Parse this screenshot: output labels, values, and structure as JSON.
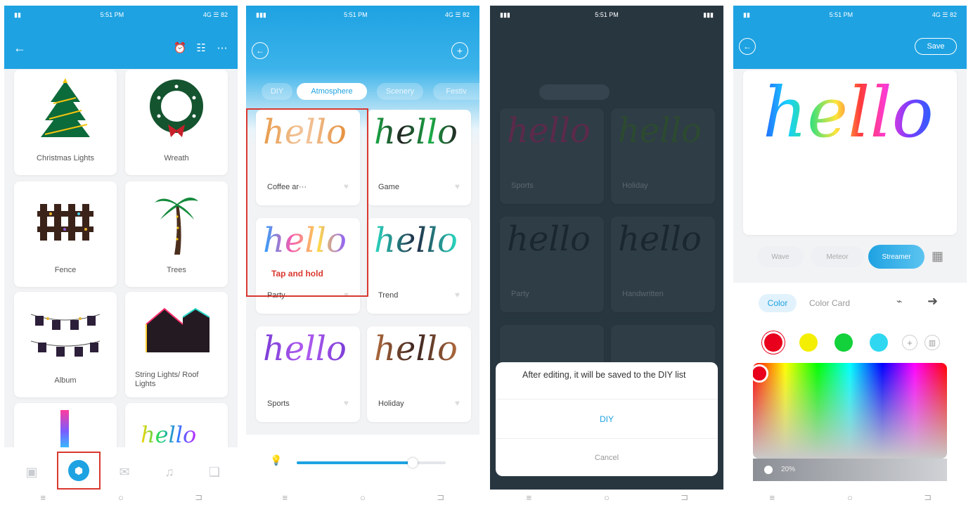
{
  "colors": {
    "brand": "#1ea2e2",
    "highlight_box": "#d9382f",
    "dialog_primary": "#1ea2e2"
  },
  "screen1": {
    "status_time": "5:51 PM",
    "status_right": "4G ☰ 82",
    "cards": [
      {
        "label": "Christmas Lights",
        "icon": "christmas-tree-icon"
      },
      {
        "label": "Wreath",
        "icon": "wreath-icon"
      },
      {
        "label": "Fence",
        "icon": "fence-icon"
      },
      {
        "label": "Trees",
        "icon": "palm-tree-icon"
      },
      {
        "label": "Album",
        "icon": "photo-album-icon"
      },
      {
        "label": "String Lights/ Roof Lights",
        "icon": "house-lights-icon"
      }
    ],
    "partial_card_text": "hello"
  },
  "screen2": {
    "status_time": "5:51 PM",
    "status_right": "4G ☰ 82",
    "tabs": [
      "DIY",
      "Atmosphere",
      "Scenery",
      "Festiv"
    ],
    "active_tab": "Atmosphere",
    "scenes": [
      {
        "label": "Coffee ar···",
        "word": "hello"
      },
      {
        "label": "Game",
        "word": "hello"
      },
      {
        "label": "Party",
        "word": "hello"
      },
      {
        "label": "Trend",
        "word": "hello"
      },
      {
        "label": "Sports",
        "word": "hello"
      },
      {
        "label": "Holiday",
        "word": "hello"
      }
    ],
    "hint": "Tap and hold",
    "brightness": 0.78
  },
  "screen3": {
    "status_time": "5:51 PM",
    "dim_labels": [
      "Sports",
      "Holiday",
      "Party",
      "Handwritten"
    ],
    "dialog_message": "After editing, it will be saved to the DIY list",
    "dialog_primary": "DIY",
    "dialog_cancel": "Cancel"
  },
  "screen4": {
    "status_time": "5:51 PM",
    "status_right": "4G ☰ 82",
    "save_label": "Save",
    "preview_word": "hello",
    "modes": [
      "Wave",
      "Meteor",
      "Streamer"
    ],
    "active_mode": "Streamer",
    "color_tabs": [
      "Color",
      "Color Card"
    ],
    "swatches": [
      "#e8001c",
      "#f4ee00",
      "#13d13a",
      "#2fd8f0"
    ],
    "brightness_text": "20%"
  },
  "nav_bar": {
    "menu": "≡",
    "home": "○",
    "back": "⊐"
  }
}
